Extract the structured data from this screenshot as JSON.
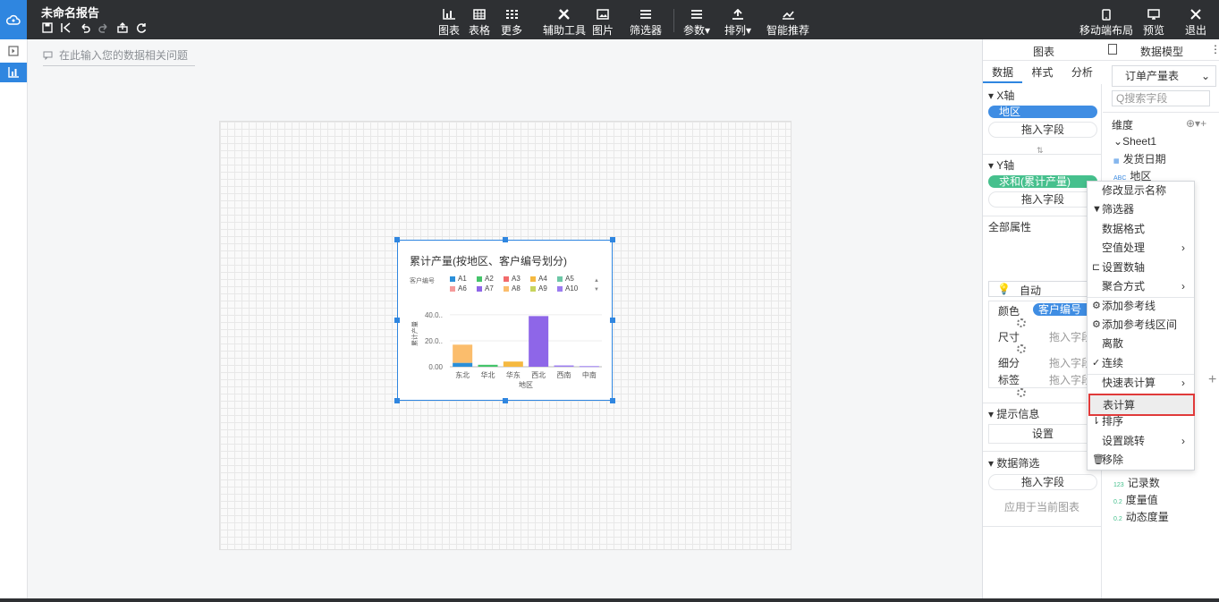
{
  "toolbar": {
    "report_title": "未命名报告",
    "buttons": {
      "chart": "图表",
      "table": "表格",
      "more": "更多",
      "aux_tools": "辅助工具",
      "image": "图片",
      "filter": "筛选器",
      "params": "参数▾",
      "arrange": "排列▾",
      "smart": "智能推荐",
      "mobile": "移动端布局",
      "preview": "预览",
      "exit": "退出"
    }
  },
  "query": {
    "placeholder": "在此输入您的数据相关问题"
  },
  "chart_data": {
    "type": "bar",
    "title": "累计产量(按地区、客户编号划分)",
    "legend_title": "客户编号",
    "legend": [
      "A1",
      "A2",
      "A3",
      "A4",
      "A5",
      "A6",
      "A7",
      "A8",
      "A9",
      "A10"
    ],
    "legend_colors": [
      "#2b8fd9",
      "#44c46a",
      "#f26b6b",
      "#f5b941",
      "#6cc7a6",
      "#f59a9a",
      "#8e66e8",
      "#fbbd6c",
      "#c8d45c",
      "#9b7cf0"
    ],
    "categories": [
      "东北",
      "华北",
      "华东",
      "西北",
      "西南",
      "中南"
    ],
    "series": [
      {
        "name": "A1",
        "values": [
          3,
          0,
          0,
          0,
          0,
          0
        ]
      },
      {
        "name": "A2",
        "values": [
          0,
          1.5,
          0,
          0,
          0,
          0
        ]
      },
      {
        "name": "A4",
        "values": [
          0,
          0,
          4,
          0,
          0,
          0
        ]
      },
      {
        "name": "A7",
        "values": [
          0,
          0,
          0,
          39,
          0,
          0
        ]
      },
      {
        "name": "A8",
        "values": [
          14,
          0,
          0,
          0,
          0,
          0
        ]
      },
      {
        "name": "A10",
        "values": [
          0,
          0,
          0,
          0,
          1,
          0.5
        ]
      }
    ],
    "xlabel": "地区",
    "ylabel": "累计产量",
    "yticks": [
      "0.00",
      "20.0..",
      "40.0.."
    ],
    "ylim": [
      0,
      42
    ]
  },
  "panel": {
    "tab_chart": "图表",
    "tab_model": "数据模型",
    "more": "⋮",
    "subtabs": [
      "数据",
      "样式",
      "分析"
    ],
    "x_axis": {
      "title": "X轴",
      "pill": "地区",
      "drop": "拖入字段"
    },
    "swap": "⇅",
    "y_axis": {
      "title": "Y轴",
      "pill": "求和(累计产量)",
      "drop": "拖入字段"
    },
    "all_props": {
      "title": "全部属性",
      "auto": "自动",
      "color_label": "颜色",
      "color_pill": "客户编号",
      "size_label": "尺寸",
      "detail_label": "细分",
      "tag_label": "标签",
      "drop": "拖入字段"
    },
    "tooltip": {
      "title": "提示信息",
      "button": "设置"
    },
    "data_filter": {
      "title": "数据筛选",
      "drop": "拖入字段",
      "apply": "应用于当前图表"
    },
    "model": {
      "select": "订单产量表",
      "search": "Q搜索字段",
      "dims_title": "维度",
      "dims_tools": "⊕▾+",
      "sheet": "Sheet1",
      "fields": [
        "发货日期",
        "地区"
      ],
      "plus": "+",
      "measures": [
        {
          "tag": "123",
          "name": "记录数"
        },
        {
          "tag": "0.2",
          "name": "度量值"
        },
        {
          "tag": "0.2",
          "name": "动态度量"
        }
      ]
    }
  },
  "context_menu": {
    "items": [
      "修改显示名称",
      "筛选器",
      "数据格式",
      "空值处理",
      "设置数轴",
      "聚合方式",
      "添加参考线",
      "添加参考线区间",
      "离散",
      "连续",
      "快速表计算",
      "表计算",
      "排序",
      "设置跳转",
      "移除"
    ],
    "arrow": "›",
    "check": "✓"
  }
}
